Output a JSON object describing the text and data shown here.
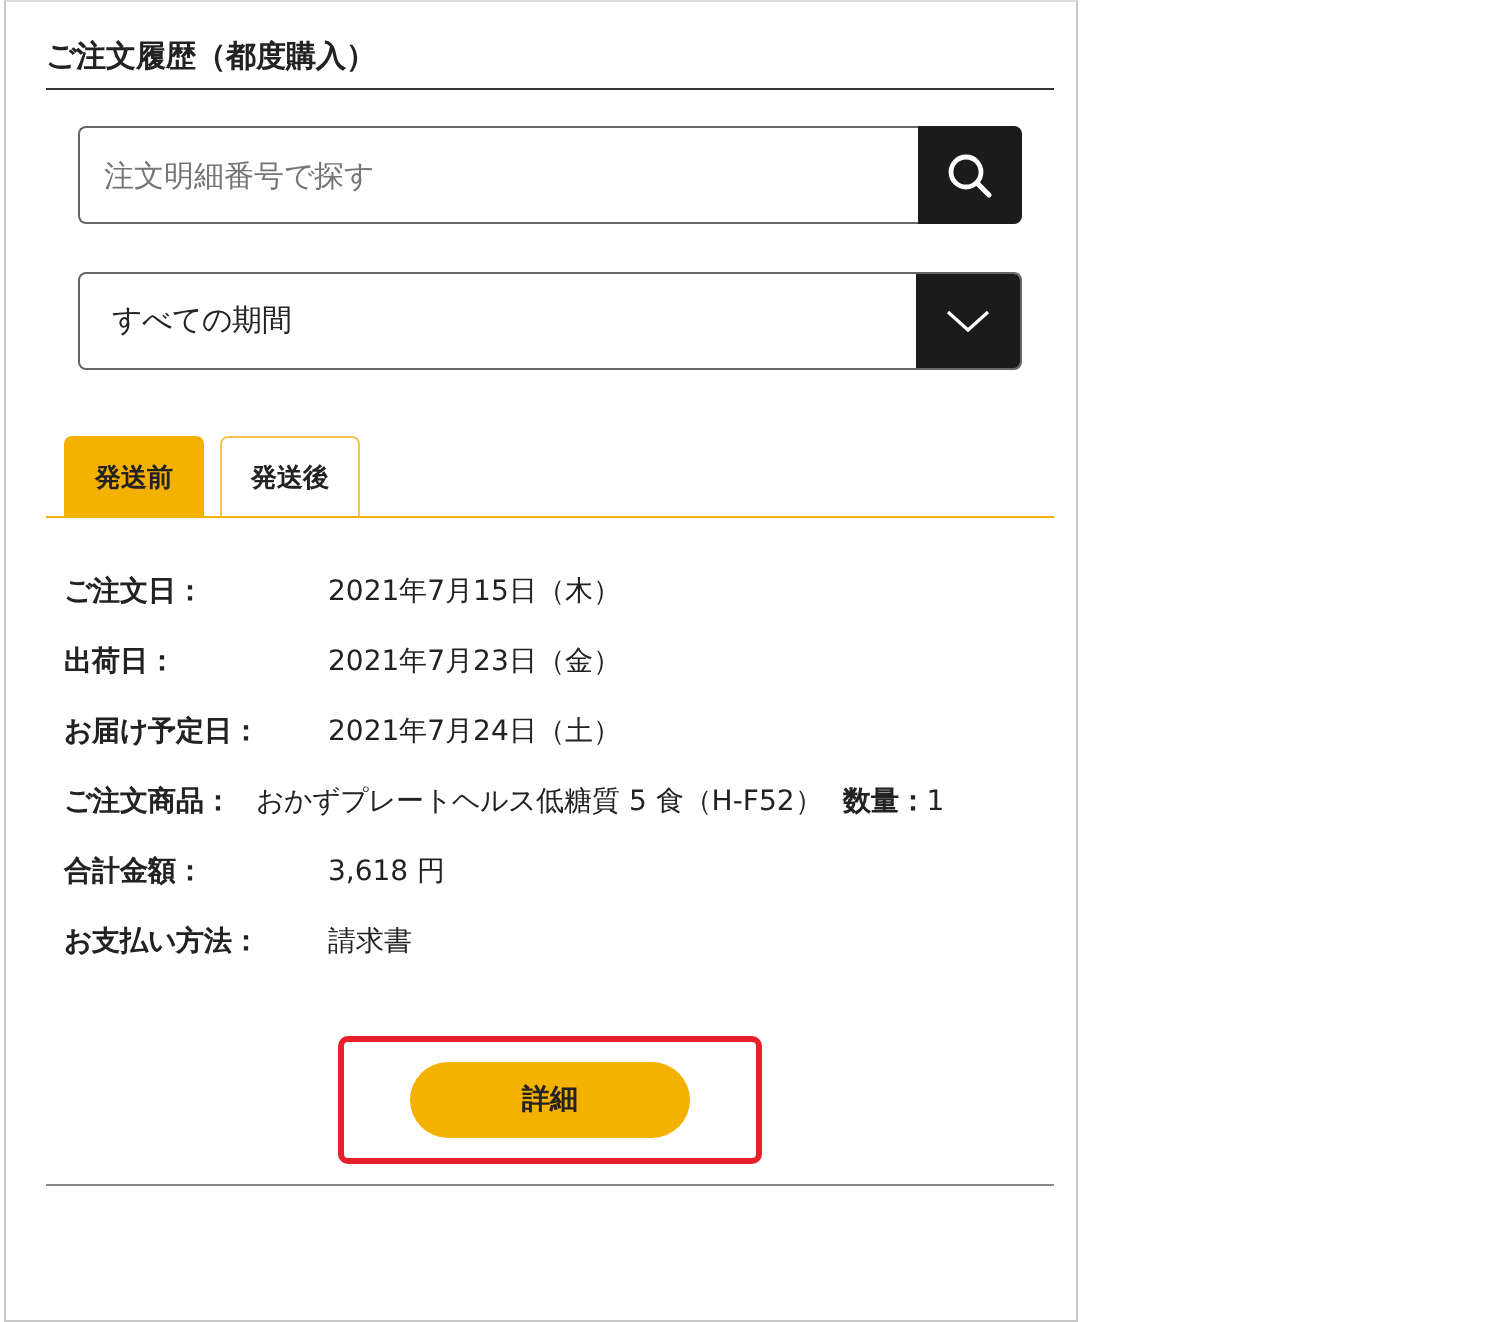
{
  "heading": "ご注文履歴（都度購入）",
  "search": {
    "placeholder": "注文明細番号で探す"
  },
  "period_select": {
    "value": "すべての期間"
  },
  "tabs": [
    {
      "label": "発送前",
      "selected": true
    },
    {
      "label": "発送後",
      "selected": false
    }
  ],
  "order": [
    {
      "label": "ご注文日：",
      "value": "2021年7月15日（木）"
    },
    {
      "label": "出荷日：",
      "value": "2021年7月23日（金）"
    },
    {
      "label": "お届け予定日：",
      "value": "2021年7月24日（土）"
    },
    {
      "label": "ご注文商品：",
      "value": "おかずプレートヘルス低糖質 5 食（H-F52）",
      "quantity_label": "数量：",
      "quantity": "1"
    },
    {
      "label": "合計金額：",
      "value": "3,618 円"
    },
    {
      "label": "お支払い方法：",
      "value": "請求書"
    }
  ],
  "detail_button": {
    "label": "詳細",
    "highlighted": true
  }
}
